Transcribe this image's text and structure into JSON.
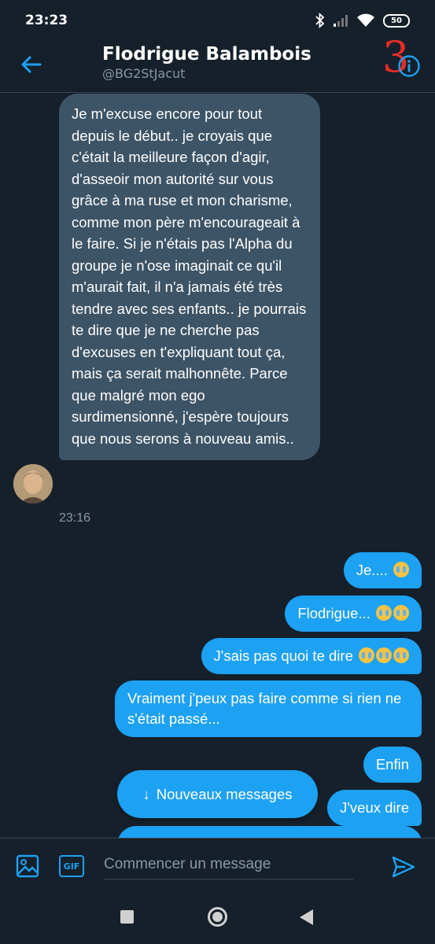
{
  "status_bar": {
    "time": "23:23",
    "battery": "50"
  },
  "header": {
    "name": "Flodrigue Balambois",
    "handle": "@BG2StJacut",
    "overlay_number": "3"
  },
  "incoming_message": {
    "text": "Je m'excuse encore pour tout depuis le début.. je croyais que c'était la meilleure façon d'agir, d'asseoir mon autorité sur vous grâce à ma ruse et mon charisme, comme mon père m'encourageait à le faire. Si je n'étais pas l'Alpha du groupe je n'ose imaginait ce qu'il m'aurait fait, il n'a jamais été très tendre avec ses enfants.. je pourrais te dire que je ne cherche pas d'excuses en t'expliquant tout ça, mais ça serait malhonnête. Parce que malgré mon ego surdimensionné, j'espère toujours que nous serons à nouveau amis..",
    "time": "23:16"
  },
  "outgoing_messages": [
    {
      "text": "Je....",
      "emoji": "loudly-crying-face",
      "emoji_count": 1
    },
    {
      "text": "Flodrigue...",
      "emoji": "loudly-crying-face",
      "emoji_count": 2
    },
    {
      "text": "J'sais pas quoi te dire",
      "emoji": "loudly-crying-face",
      "emoji_count": 3
    },
    {
      "text": "Vraiment j'peux pas faire comme si rien ne s'était passé...",
      "emoji_count": 0
    },
    {
      "text": "Enfin",
      "emoji_count": 0
    },
    {
      "text": "J'veux dire",
      "emoji_count": 0
    }
  ],
  "new_messages_pill": {
    "label": "Nouveaux messages",
    "arrow": "↓"
  },
  "compose": {
    "placeholder": "Commencer un message",
    "gif_label": "GIF"
  },
  "colors": {
    "background": "#15202b",
    "accent": "#1da1f2",
    "incoming_bubble": "#3d5466",
    "secondary_text": "#8899a6"
  }
}
